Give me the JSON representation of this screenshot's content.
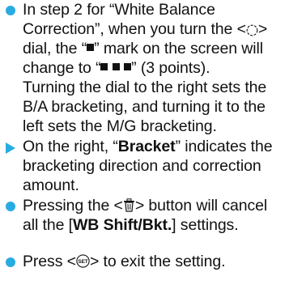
{
  "bullets": [
    {
      "marker": "dot",
      "parts": {
        "a": "In step 2 for “White Balance",
        "b": "Correction”, when you turn the <",
        "c": ">",
        "d": "dial, the “",
        "e": "” mark on the screen will",
        "f": "change to “",
        "g": "” (3 points).",
        "h": "Turning the dial to the right sets the",
        "i": "B/A bracketing, and turning it to the",
        "j": "left sets the M/G bracketing."
      }
    },
    {
      "marker": "triangle",
      "parts": {
        "a": "On the right, “",
        "b": "Bracket",
        "c": "” indicates the",
        "d": "bracketing direction and correction",
        "e": "amount."
      }
    },
    {
      "marker": "dot",
      "parts": {
        "a": "Pressing the <",
        "b": "> button will cancel",
        "c": "all the [",
        "d": "WB Shift/Bkt.",
        "e": "] settings."
      }
    },
    {
      "marker": "dot",
      "parts": {
        "a": "Press <",
        "b": "> to exit the setting."
      }
    }
  ],
  "icons": {
    "dial": "quick-control-dial-icon",
    "trash": "erase-button-icon",
    "set": "set-button-icon",
    "mark": "square-mark-icon"
  },
  "colors": {
    "accent": "#29abe2",
    "text": "#111111"
  }
}
